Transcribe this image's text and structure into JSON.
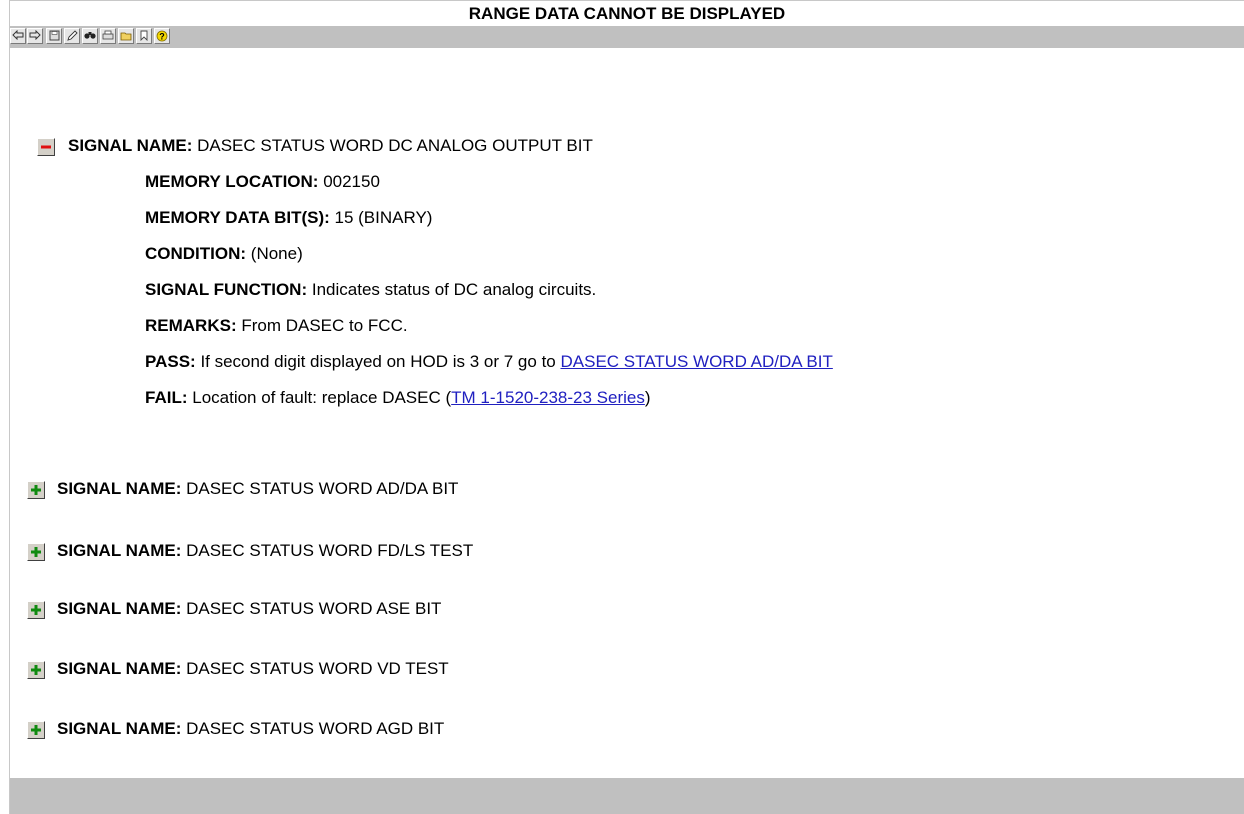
{
  "header": {
    "title": "RANGE DATA CANNOT BE DISPLAYED"
  },
  "toolbar": {
    "buttons": [
      {
        "name": "back-button",
        "icon": "back-arrow-icon"
      },
      {
        "name": "forward-button",
        "icon": "forward-arrow-icon"
      },
      {
        "name": "save-button",
        "icon": "disk-icon"
      },
      {
        "name": "edit-button",
        "icon": "pen-icon"
      },
      {
        "name": "find-button",
        "icon": "binoculars-icon"
      },
      {
        "name": "print-button",
        "icon": "printer-icon"
      },
      {
        "name": "open-button",
        "icon": "folder-icon"
      },
      {
        "name": "bookmark-button",
        "icon": "bookmark-icon"
      },
      {
        "name": "help-button",
        "icon": "help-icon"
      }
    ]
  },
  "expanded_signal": {
    "toggle": "minus",
    "signal_name_label": "SIGNAL NAME:",
    "signal_name": "DASEC STATUS WORD DC ANALOG OUTPUT BIT",
    "memory_location_label": "MEMORY LOCATION:",
    "memory_location": "002150",
    "memory_data_bits_label": "MEMORY DATA BIT(S):",
    "memory_data_bits": "15 (BINARY)",
    "condition_label": "CONDITION:",
    "condition": "(None)",
    "signal_function_label": "SIGNAL FUNCTION:",
    "signal_function": "Indicates status of DC analog circuits.",
    "remarks_label": "REMARKS:",
    "remarks": "From DASEC to FCC.",
    "pass_label": "PASS:",
    "pass_text": "If second digit displayed on HOD is 3 or 7 go to",
    "pass_link": "DASEC STATUS WORD AD/DA BIT",
    "fail_label": "FAIL:",
    "fail_text": "Location of fault: replace DASEC (",
    "fail_link": "TM 1-1520-238-23 Series",
    "fail_close": ")"
  },
  "collapsed_signals": [
    {
      "label": "SIGNAL NAME:",
      "name": "DASEC STATUS WORD AD/DA BIT"
    },
    {
      "label": "SIGNAL NAME:",
      "name": "DASEC STATUS WORD FD/LS TEST"
    },
    {
      "label": "SIGNAL NAME:",
      "name": "DASEC STATUS WORD ASE BIT"
    },
    {
      "label": "SIGNAL NAME:",
      "name": "DASEC STATUS WORD VD TEST"
    },
    {
      "label": "SIGNAL NAME:",
      "name": "DASEC STATUS WORD AGD BIT"
    }
  ],
  "colors": {
    "toolbar_bg": "#c0c0c0",
    "link": "#2020c0",
    "minus": "#e01010",
    "plus": "#108a10"
  }
}
